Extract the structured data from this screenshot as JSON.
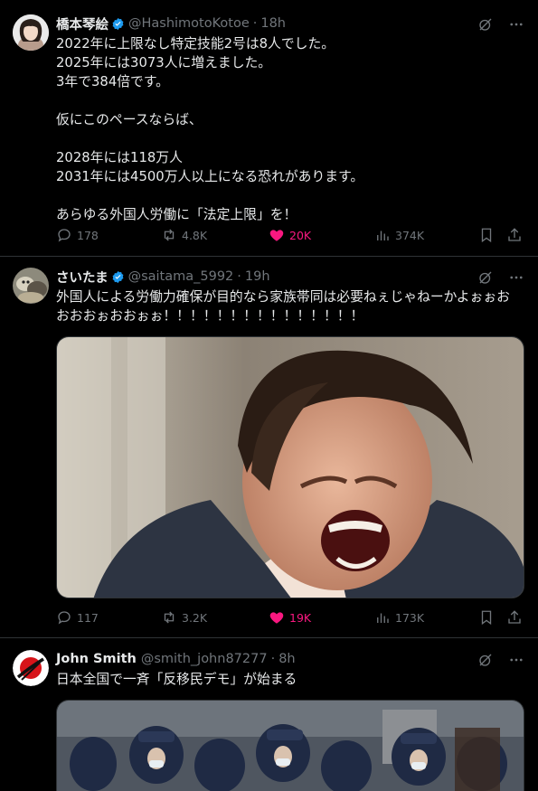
{
  "tweets": [
    {
      "name": "橋本琴絵",
      "handle": "@HashimotoKotoe",
      "time": "18h",
      "verified": true,
      "text": "2022年に上限なし特定技能2号は8人でした。\n2025年には3073人に増えました。\n3年で384倍です。\n\n仮にこのペースならば、\n\n2028年には118万人\n2031年には4500万人以上になる恐れがあります。\n\nあらゆる外国人労働に「法定上限」を！",
      "replies": "178",
      "reposts": "4.8K",
      "likes": "20K",
      "views": "374K"
    },
    {
      "name": "さいたま",
      "handle": "@saitama_5992",
      "time": "19h",
      "verified": true,
      "text": "外国人による労働力確保が目的なら家族帯同は必要ねぇじゃねーかよぉぉお\nおおおぉおおぉぉ！！！！！！！！！！！！！！！",
      "replies": "117",
      "reposts": "3.2K",
      "likes": "19K",
      "views": "173K"
    },
    {
      "name": "John Smith",
      "handle": "@smith_john87277",
      "time": "8h",
      "verified": false,
      "text": "日本全国で一斉「反移民デモ」が始まる"
    }
  ],
  "colors": {
    "background": "#000000",
    "text": "#e7e9ea",
    "muted": "#71767b",
    "like": "#f91880",
    "verified": "#1d9bf0"
  },
  "icons": [
    "grok-icon",
    "more-icon",
    "reply-icon",
    "repost-icon",
    "like-icon",
    "views-icon",
    "bookmark-icon",
    "share-icon"
  ]
}
